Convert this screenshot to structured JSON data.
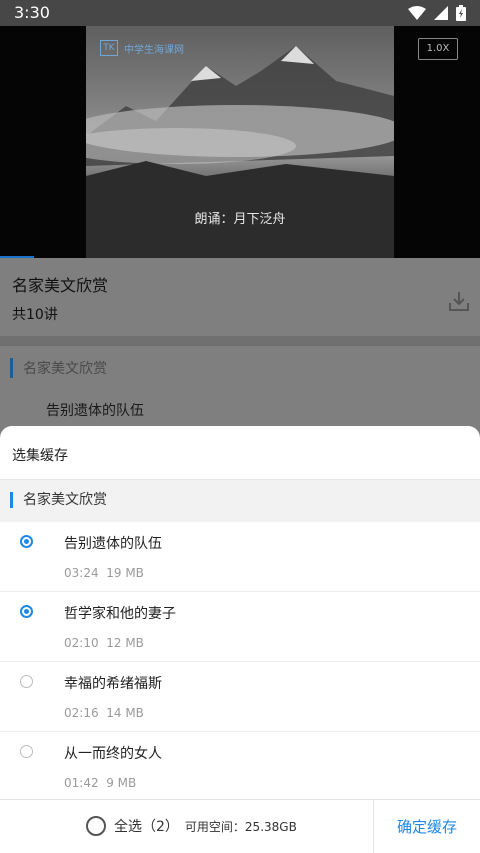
{
  "status": {
    "time": "3:30",
    "icons": [
      "wifi-icon",
      "signal-icon",
      "battery-icon"
    ]
  },
  "video": {
    "logo_text": "中学生海课网",
    "logo_mark": "TK",
    "subtitle": "朗诵：月下泛舟",
    "speed": "1.0X",
    "progress_fraction": 0.07
  },
  "course": {
    "title": "名家美文欣赏",
    "lesson_count": "共10讲"
  },
  "background_list": {
    "section": "名家美文欣赏",
    "first_item": "告别遗体的队伍"
  },
  "sheet": {
    "title": "选集缓存",
    "section": "名家美文欣赏",
    "episodes": [
      {
        "title": "告别遗体的队伍",
        "duration": "03:24",
        "size": "19 MB",
        "selected": true
      },
      {
        "title": "哲学家和他的妻子",
        "duration": "02:10",
        "size": "12 MB",
        "selected": true
      },
      {
        "title": "幸福的希绪福斯",
        "duration": "02:16",
        "size": "14 MB",
        "selected": false
      },
      {
        "title": "从一而终的女人",
        "duration": "01:42",
        "size": "9 MB",
        "selected": false
      }
    ],
    "select_all_label": "全选（2）",
    "space_label": "可用空间：25.38GB",
    "confirm_label": "确定缓存"
  },
  "colors": {
    "accent": "#1e88e5",
    "status_bar": "#474747",
    "overlay": "#7f7f7f"
  }
}
